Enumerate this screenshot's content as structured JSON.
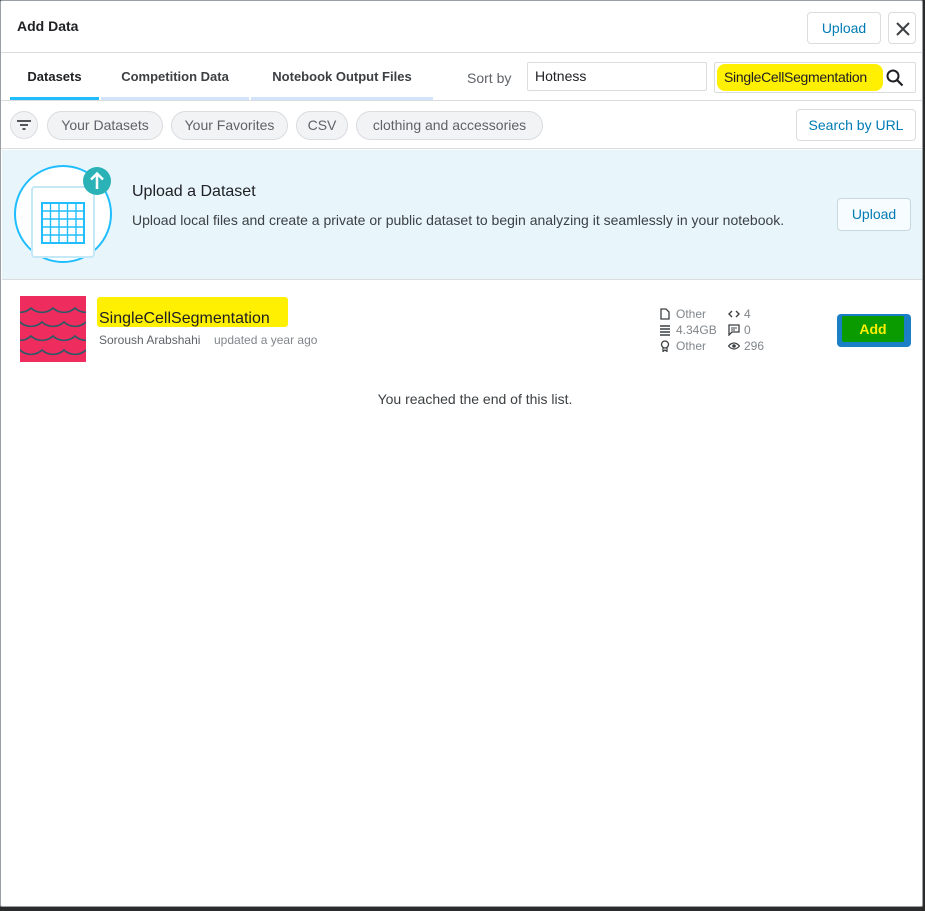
{
  "header": {
    "title": "Add Data",
    "upload_label": "Upload"
  },
  "tabs": [
    {
      "label": "Datasets",
      "active": true
    },
    {
      "label": "Competition Data",
      "active": false
    },
    {
      "label": "Notebook Output Files",
      "active": false
    }
  ],
  "sort": {
    "label": "Sort by",
    "value": "Hotness"
  },
  "search": {
    "value": "SingleCellSegmentation"
  },
  "filters": {
    "chips": [
      "Your Datasets",
      "Your Favorites",
      "CSV",
      "clothing and accessories"
    ],
    "search_by_url": "Search by URL"
  },
  "upload_banner": {
    "title": "Upload a Dataset",
    "description": "Upload local files and create a private or public dataset to begin analyzing it seamlessly in your notebook.",
    "button": "Upload"
  },
  "dataset": {
    "title": "SingleCellSegmentation",
    "author": "Soroush Arabshahi",
    "updated": "updated a year ago",
    "file_type": "Other",
    "size": "4.34GB",
    "license": "Other",
    "code_count": "4",
    "discussion_count": "0",
    "views": "296",
    "add_label": "Add"
  },
  "footer_text": "You reached the end of this list.",
  "colors": {
    "accent": "#20beff",
    "highlight": "#ffef00",
    "link": "#007bb5",
    "thumb": "#ef2c5e"
  }
}
